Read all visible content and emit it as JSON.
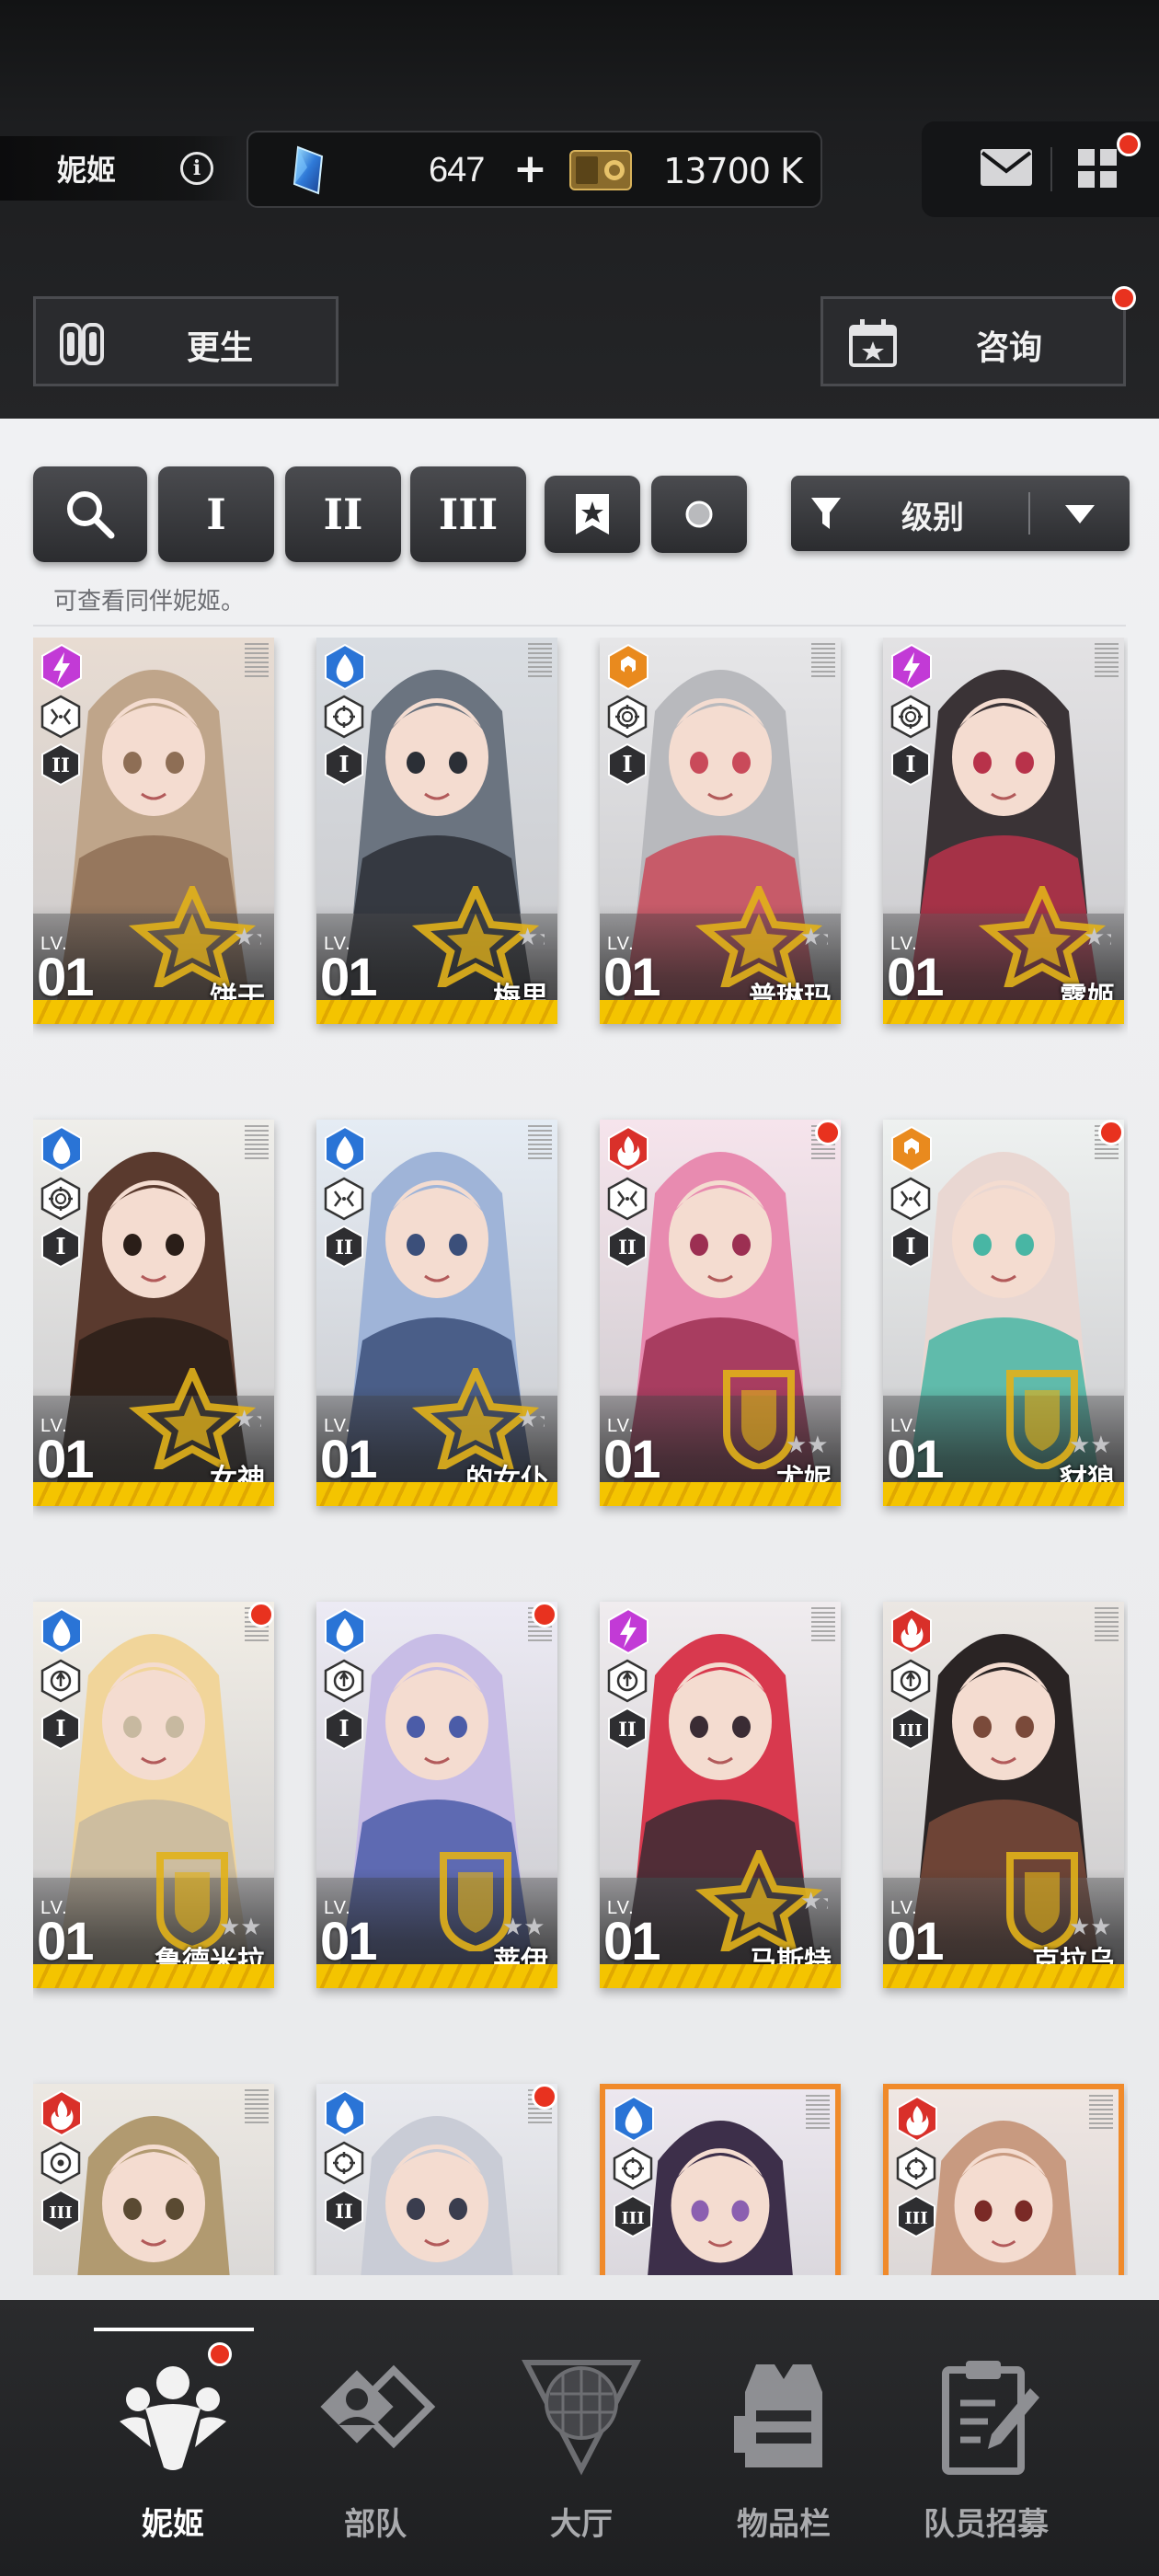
{
  "header": {
    "player_name": "妮姬",
    "gem_count": "647",
    "gem_plus": "+",
    "credit_count": "13700 K"
  },
  "actions": {
    "rebirth_label": "更生",
    "consult_label": "咨询"
  },
  "filters": {
    "burst_1": "I",
    "burst_2": "II",
    "burst_3": "III",
    "sort_label": "级别"
  },
  "hint_text": "可查看同伴妮姬。",
  "colors": {
    "fire": "#d9302a",
    "water": "#2a74d6",
    "electric": "#c23ad6",
    "wind": "#e98a1e",
    "iron": "#e98a1e",
    "accent_yellow": "#f4c400",
    "notification": "#e8321f"
  },
  "cards": [
    {
      "name": "饼干",
      "lv_label": "LV.",
      "level": "01",
      "element": "electric",
      "weapon": "mg",
      "burst": "II",
      "notify": false,
      "frame": "normal",
      "emblem": "star"
    },
    {
      "name": "梅里",
      "lv_label": "LV.",
      "level": "01",
      "element": "water",
      "weapon": "ar",
      "burst": "I",
      "notify": false,
      "frame": "normal",
      "emblem": "star"
    },
    {
      "name": "普琳玛",
      "lv_label": "LV.",
      "level": "01",
      "element": "wind",
      "weapon": "sr",
      "burst": "I",
      "notify": false,
      "frame": "normal",
      "emblem": "star"
    },
    {
      "name": "露姬",
      "lv_label": "LV.",
      "level": "01",
      "element": "electric",
      "weapon": "sr",
      "burst": "I",
      "notify": false,
      "frame": "normal",
      "emblem": "star"
    },
    {
      "name": "女神",
      "lv_label": "LV.",
      "level": "01",
      "element": "water",
      "weapon": "sr",
      "burst": "I",
      "notify": false,
      "frame": "normal",
      "emblem": "star"
    },
    {
      "name": "的女仆",
      "lv_label": "LV.",
      "level": "01",
      "element": "water",
      "weapon": "mg",
      "burst": "II",
      "notify": false,
      "frame": "normal",
      "emblem": "star"
    },
    {
      "name": "尤妮",
      "lv_label": "LV.",
      "level": "01",
      "element": "fire",
      "weapon": "mg",
      "burst": "II",
      "notify": true,
      "frame": "normal",
      "emblem": "shield"
    },
    {
      "name": "豺狼",
      "lv_label": "LV.",
      "level": "01",
      "element": "wind",
      "weapon": "mg",
      "burst": "I",
      "notify": true,
      "frame": "normal",
      "emblem": "shield"
    },
    {
      "name": "鲁德米拉",
      "lv_label": "LV.",
      "level": "01",
      "element": "water",
      "weapon": "rl",
      "burst": "I",
      "notify": true,
      "frame": "normal",
      "emblem": "shield"
    },
    {
      "name": "莱伊",
      "lv_label": "LV.",
      "level": "01",
      "element": "water",
      "weapon": "rl",
      "burst": "I",
      "notify": true,
      "frame": "normal",
      "emblem": "shield"
    },
    {
      "name": "马斯特",
      "lv_label": "LV.",
      "level": "01",
      "element": "electric",
      "weapon": "rl",
      "burst": "II",
      "notify": false,
      "frame": "normal",
      "emblem": "star"
    },
    {
      "name": "克拉乌",
      "lv_label": "LV.",
      "level": "01",
      "element": "fire",
      "weapon": "rl",
      "burst": "III",
      "notify": false,
      "frame": "normal",
      "emblem": "shield"
    },
    {
      "name": "",
      "lv_label": "",
      "level": "",
      "element": "fire",
      "weapon": "sg",
      "burst": "III",
      "notify": false,
      "frame": "normal",
      "emblem": "none"
    },
    {
      "name": "",
      "lv_label": "",
      "level": "",
      "element": "water",
      "weapon": "ar",
      "burst": "II",
      "notify": true,
      "frame": "normal",
      "emblem": "none"
    },
    {
      "name": "",
      "lv_label": "",
      "level": "",
      "element": "water",
      "weapon": "ar",
      "burst": "III",
      "notify": false,
      "frame": "sc",
      "emblem": "none"
    },
    {
      "name": "",
      "lv_label": "",
      "level": "",
      "element": "fire",
      "weapon": "ar",
      "burst": "III",
      "notify": false,
      "frame": "sc",
      "emblem": "none"
    }
  ],
  "nav": {
    "items": [
      {
        "label": "妮姬",
        "active": true,
        "notify": true
      },
      {
        "label": "部队",
        "active": false,
        "notify": false
      },
      {
        "label": "大厅",
        "active": false,
        "notify": false
      },
      {
        "label": "物品栏",
        "active": false,
        "notify": false
      },
      {
        "label": "队员招募",
        "active": false,
        "notify": false
      }
    ]
  }
}
